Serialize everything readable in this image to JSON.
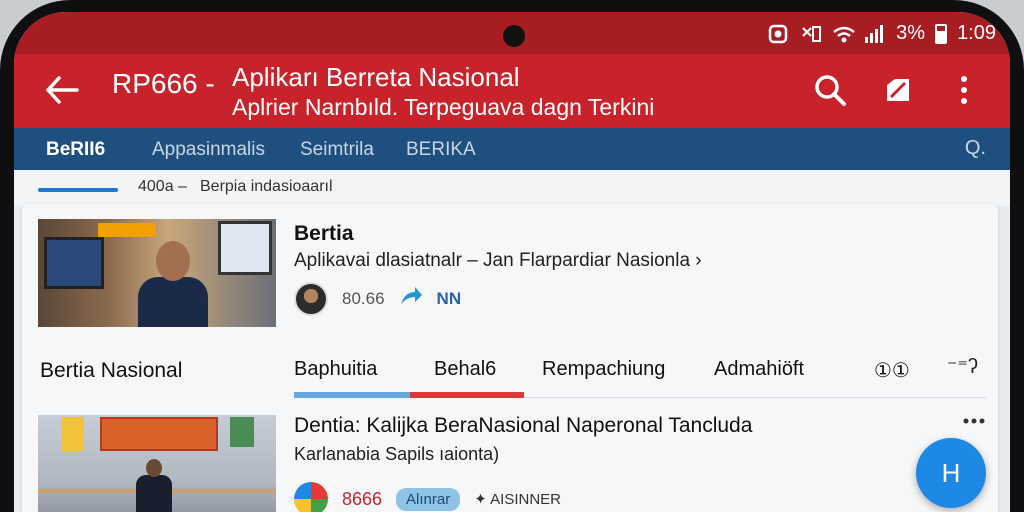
{
  "status_bar": {
    "battery_text": "3%",
    "time": "1:09"
  },
  "app_bar": {
    "code": "RP666 -",
    "title": "Aplikarı Berreta Nasional",
    "subtitle": "Aplrier Narnbıld. Terpeguava dagn Terkini"
  },
  "nav": {
    "tabs": [
      {
        "label": "BeRII6",
        "active": true
      },
      {
        "label": "Appasinmalis"
      },
      {
        "label": "Seimtrila"
      },
      {
        "label": "BERIKA"
      }
    ],
    "search_label": "Q."
  },
  "sub_strip": {
    "count": "400a –",
    "label": "Berpia indasioaarıl"
  },
  "article1": {
    "title": "Bertia",
    "description": "Aplikavai dlasiatnalr – Jan Flarpardiar Nasionla ›",
    "count": "80.66",
    "tag": "NN"
  },
  "section": {
    "title": "Bertia Nasional"
  },
  "categories": {
    "tabs": [
      "Baphuitia",
      "Behal6",
      "Rempachiung",
      "Admahiöft",
      "①①"
    ],
    "more": "⁻⁼ʔ"
  },
  "article2": {
    "title": "Dentia: Kalijka BeraNasional Naperonal Tancluda",
    "description": "Karlanabia Sapils ıaionta)",
    "count": "8666",
    "pill": "Alınrar",
    "badge": "✦ AISINNER"
  },
  "fab": {
    "label": "H"
  },
  "colors": {
    "status_bar": "#a81d22",
    "app_bar": "#c8232b",
    "nav_bar": "#1e4f7e",
    "fab": "#1e88e5"
  }
}
